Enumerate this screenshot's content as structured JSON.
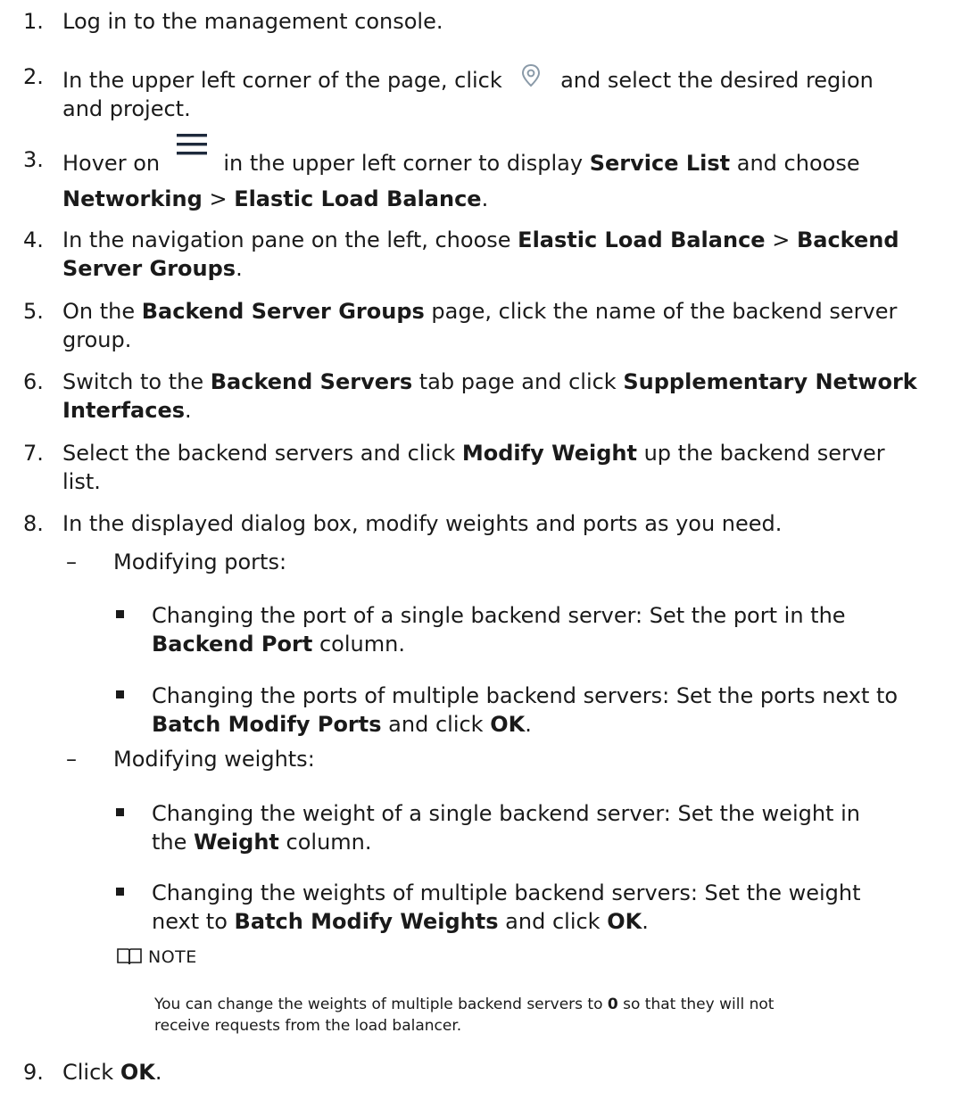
{
  "steps": [
    {
      "num": "1.",
      "parts": [
        "Log in to the management console."
      ]
    },
    {
      "num": "2.",
      "before": "In the upper left corner of the page, click",
      "after": "and select the desired region",
      "line2": "and project."
    },
    {
      "num": "3.",
      "before": "Hover on",
      "after": "in the upper left corner to display",
      "b1": "Service List",
      "t1": "and choose",
      "b2": "Networking",
      "t2": ">",
      "b3": "Elastic Load Balance",
      "t3": "."
    },
    {
      "num": "4.",
      "t0": "In the navigation pane on the left, choose",
      "b1": "Elastic Load Balance",
      "t1": ">",
      "b2": "Backend",
      "b3": "Server Groups",
      "t3": "."
    },
    {
      "num": "5.",
      "t0": "On the",
      "b1": "Backend Server Groups",
      "t1": "page, click the name of the backend server",
      "line2": "group."
    },
    {
      "num": "6.",
      "t0": "Switch to the",
      "b1": "Backend Servers",
      "t1": "tab page and click",
      "b2": "Supplementary Network",
      "b3": "Interfaces",
      "t3": "."
    },
    {
      "num": "7.",
      "t0": "Select the backend servers and click",
      "b1": "Modify Weight",
      "t1": "up the backend server",
      "line2": "list."
    },
    {
      "num": "8.",
      "t0": "In the displayed dialog box, modify weights and ports as you need."
    },
    {
      "num": "9.",
      "t0": "Click",
      "b1": "OK",
      "t1": "."
    }
  ],
  "ports": {
    "dash": "–",
    "label": "Modifying ports:",
    "single_t0": "Changing the port of a single backend server: Set the port in the",
    "single_b": "Backend Port",
    "single_t1": "column.",
    "multi_t0": "Changing the ports of multiple backend servers: Set the ports next to",
    "multi_b": "Batch Modify Ports",
    "multi_t1": "and click",
    "multi_b2": "OK",
    "multi_t2": "."
  },
  "weights": {
    "dash": "–",
    "label": "Modifying weights:",
    "single_t0": "Changing the weight of a single backend server: Set the weight in",
    "single_t1": "the",
    "single_b": "Weight",
    "single_t2": "column.",
    "multi_t0": "Changing the weights of multiple backend servers: Set the weight",
    "multi_t1": "next to",
    "multi_b": "Batch Modify Weights",
    "multi_t2": "and click",
    "multi_b2": "OK",
    "multi_t3": "."
  },
  "note": {
    "heading": "NOTE",
    "t0": "You can change the weights of multiple backend servers to",
    "b": "0",
    "t1": "so that they will not",
    "line2": "receive requests from the load balancer."
  },
  "icons": {
    "location": "location-pin-icon",
    "menu": "hamburger-menu-icon",
    "note": "book-icon"
  }
}
